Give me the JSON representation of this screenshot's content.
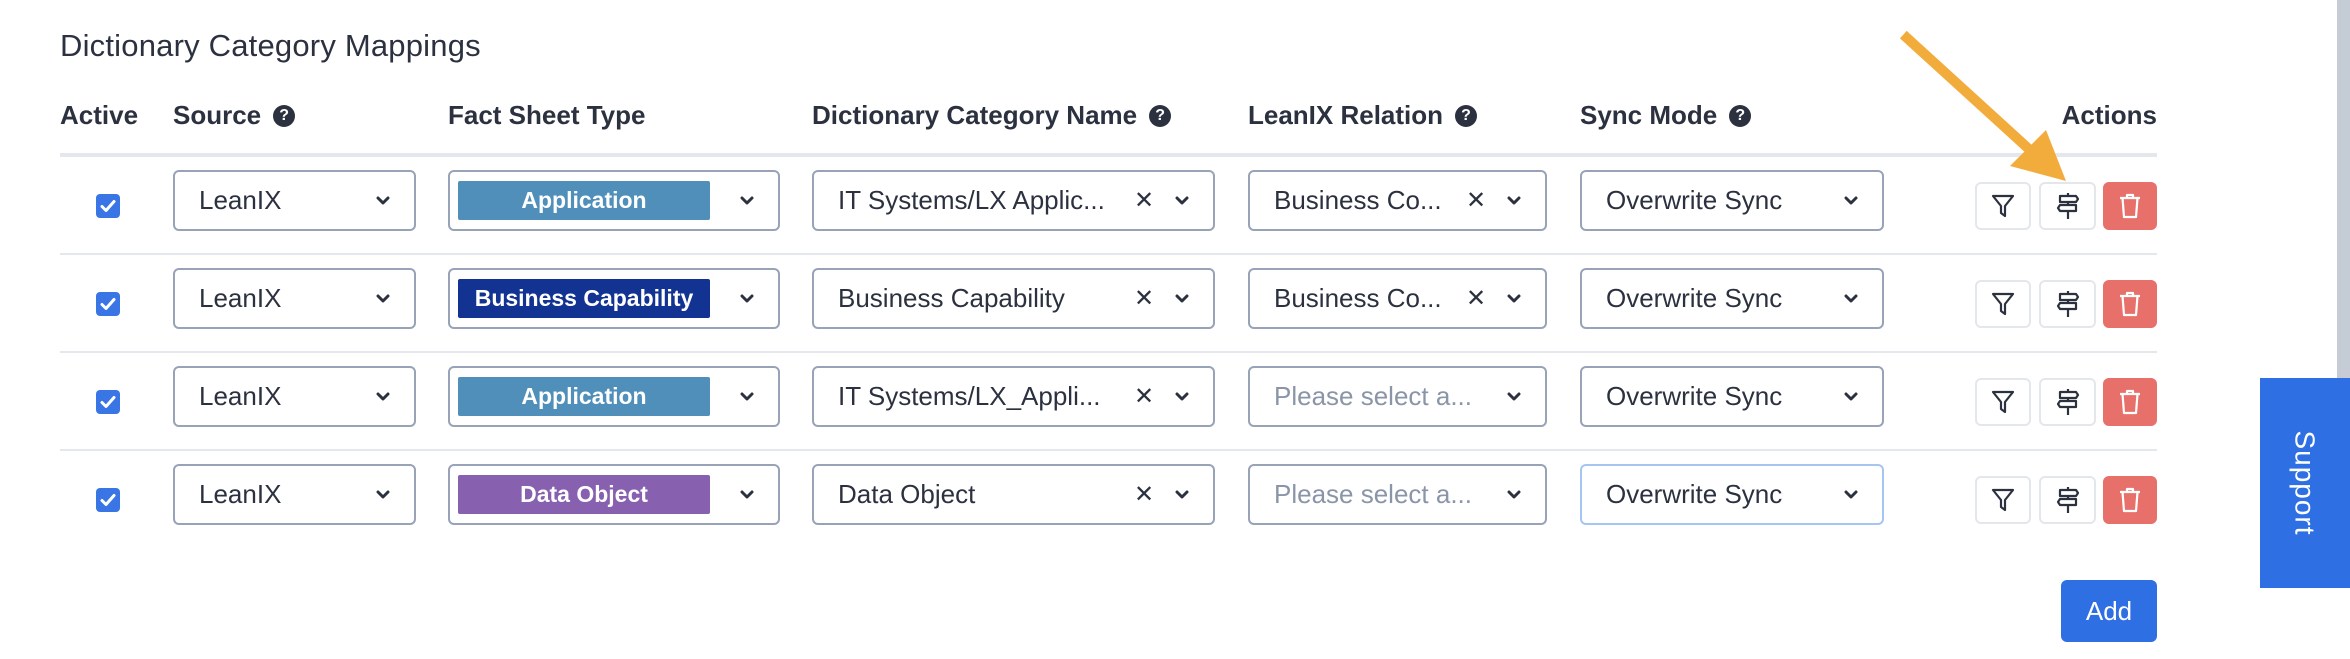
{
  "title": "Dictionary Category Mappings",
  "columns": {
    "active": "Active",
    "source": "Source",
    "fact_sheet_type": "Fact Sheet Type",
    "dictionary_category_name": "Dictionary Category Name",
    "leanix_relation": "LeanIX Relation",
    "sync_mode": "Sync Mode",
    "actions": "Actions"
  },
  "help_glyph": "?",
  "rows": [
    {
      "active": true,
      "source": "LeanIX",
      "fact_sheet_type": {
        "label": "Application",
        "color": "#4f8fba"
      },
      "dictionary_category_name": "IT Systems/LX Applic...",
      "leanix_relation": {
        "value": "Business Co...",
        "placeholder": null
      },
      "sync_mode": "Overwrite Sync"
    },
    {
      "active": true,
      "source": "LeanIX",
      "fact_sheet_type": {
        "label": "Business Capability",
        "color": "#133393"
      },
      "dictionary_category_name": "Business Capability",
      "leanix_relation": {
        "value": "Business Co...",
        "placeholder": null
      },
      "sync_mode": "Overwrite Sync"
    },
    {
      "active": true,
      "source": "LeanIX",
      "fact_sheet_type": {
        "label": "Application",
        "color": "#4f8fba"
      },
      "dictionary_category_name": "IT Systems/LX_Appli...",
      "leanix_relation": {
        "value": null,
        "placeholder": "Please select a..."
      },
      "sync_mode": "Overwrite Sync"
    },
    {
      "active": true,
      "source": "LeanIX",
      "fact_sheet_type": {
        "label": "Data Object",
        "color": "#8760b0"
      },
      "dictionary_category_name": "Data Object",
      "leanix_relation": {
        "value": null,
        "placeholder": "Please select a..."
      },
      "sync_mode": "Overwrite Sync"
    }
  ],
  "actions": {
    "filter_icon": "filter-icon",
    "signpost_icon": "signpost-icon",
    "delete_icon": "trash-icon"
  },
  "add_label": "Add",
  "support_label": "Support",
  "colors": {
    "primary": "#2f6fe4",
    "checkbox": "#3a75e6",
    "danger": "#e8706a",
    "annotation_arrow": "#f2ac3b",
    "text": "#2c3140",
    "placeholder": "#8a95a8"
  },
  "focused_row_sync_mode": 3
}
